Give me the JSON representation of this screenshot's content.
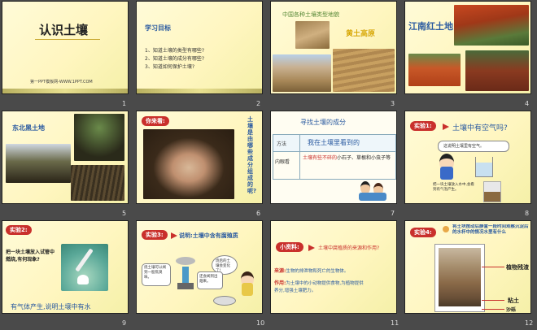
{
  "slides": [
    {
      "num": "1",
      "title": "认识土壤",
      "footer": "第一PPT模板网-WWW.1PPT.COM"
    },
    {
      "num": "2",
      "title": "学习目标",
      "items": [
        "1、知道土壤的类型有哪些?",
        "2、知道土壤的成分有哪些?",
        "3、知道如何保护土壤?"
      ]
    },
    {
      "num": "3",
      "title": "中国各种土壤类型地貌",
      "label": "黄土高原"
    },
    {
      "num": "4",
      "title": "江南红土地"
    },
    {
      "num": "5",
      "title": "东北黑土地"
    },
    {
      "num": "6",
      "badge": "你来看:",
      "vertical": "土壤是由哪些成分组成的呢?"
    },
    {
      "num": "7",
      "title": "寻找土壤的成分",
      "method_label": "方法",
      "method_value": "我在土壤里看到的",
      "row_label": "内眼看",
      "row_value_red": "土壤有些不碎的",
      "row_value_rest": "小石子、草根和小虫子等"
    },
    {
      "num": "8",
      "badge": "实验1:",
      "title": "土壤中有空气吗?",
      "bubble": "这说明土壤里有空气。",
      "caption": "把一块土壤放入水中,会看到有气泡产生。"
    },
    {
      "num": "9",
      "badge": "实验2:",
      "question": "把一块土壤放入试管中燃烧,有何现象?",
      "answer": "有气体产生,说明土壤中有水"
    },
    {
      "num": "10",
      "badge": "实验3:",
      "title": "说明:土壤中含有腐殖质",
      "bubble1": "烧土壤可以闻到一股焦臭味。",
      "bubble2": "烧后的土壤会变化了!",
      "bubble3": "还会闻到出烟来。"
    },
    {
      "num": "11",
      "badge": "小资料:",
      "title": "土壤中腐殖质的来源和作用?",
      "source_label": "来源:",
      "source_text": "生物的排泄物和死亡的生物体。",
      "use_label": "作用:",
      "use_text": "为土壤中的小动物提供食物,为植物提供养分,增强土壤肥力。"
    },
    {
      "num": "12",
      "badge": "实验4:",
      "title": "将土块搅动后静置一段时间观察沉淀后的水杯中的情况水里有什么",
      "labels": [
        "植物残渣",
        "粘土",
        "沙砾"
      ]
    }
  ]
}
